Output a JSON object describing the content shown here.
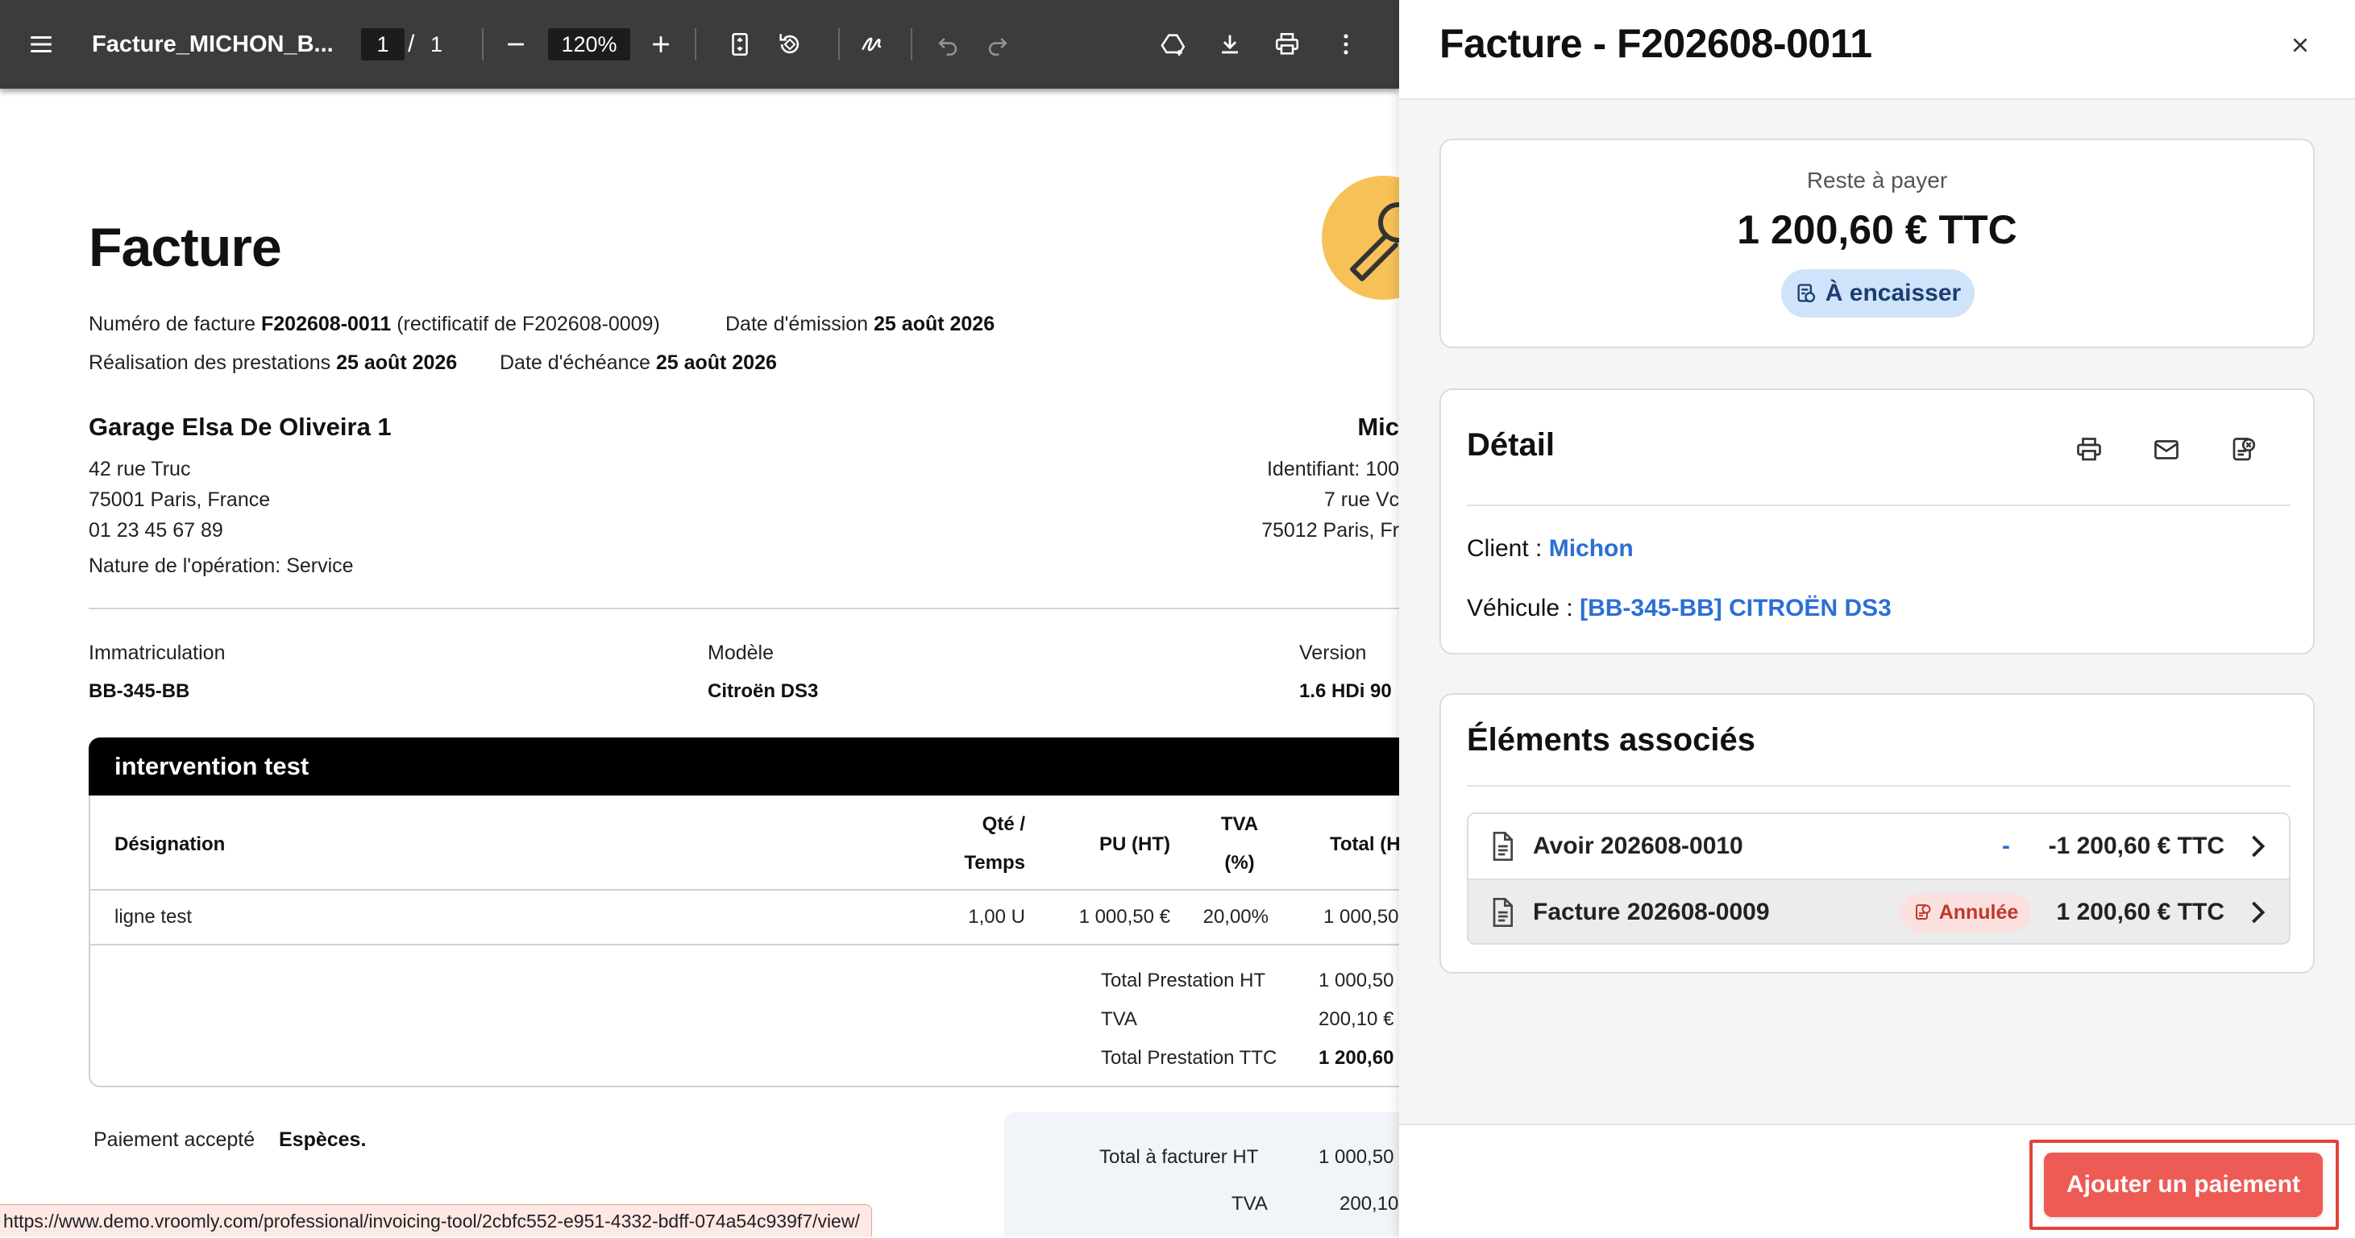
{
  "viewer": {
    "file_title": "Facture_MICHON_B...",
    "page_current": "1",
    "page_separator": "/",
    "page_total": "1",
    "zoom": "120%"
  },
  "pdf": {
    "title": "Facture",
    "meta": {
      "num_label": "Numéro de facture",
      "num_value": "F202608-0011",
      "rectif": "(rectificatif de F202608-0009)",
      "emission_label": "Date d'émission",
      "emission_value": "25 août 2026",
      "realisation_label": "Réalisation des prestations",
      "realisation_value": "25 août 2026",
      "echeance_label": "Date d'échéance",
      "echeance_value": "25 août 2026"
    },
    "garage": {
      "name": "Garage Elsa De Oliveira 1",
      "street": "42 rue Truc",
      "city": "75001 Paris, France",
      "phone": "01 23 45 67 89",
      "nature": "Nature de l'opération: Service"
    },
    "client": {
      "name": "Mic",
      "ident": "Identifiant: 100",
      "street": "7 rue Vc",
      "city": "75012 Paris, Fr"
    },
    "vehicle": {
      "immat_label": "Immatriculation",
      "immat_value": "BB-345-BB",
      "model_label": "Modèle",
      "model_value": "Citroën DS3",
      "version_label": "Version",
      "version_value": "1.6 HDi 90"
    },
    "intervention": {
      "title": "intervention test",
      "headers": {
        "designation": "Désignation",
        "qty_line1": "Qté /",
        "qty_line2": "Temps",
        "pu": "PU (HT)",
        "tva_line1": "TVA",
        "tva_line2": "(%)",
        "total": "Total (H"
      },
      "rows": [
        {
          "designation": "ligne test",
          "qty": "1,00 U",
          "pu": "1 000,50 €",
          "tva": "20,00%",
          "total": "1 000,50"
        }
      ],
      "totals": [
        {
          "label": "Total Prestation HT",
          "value": "1 000,50"
        },
        {
          "label": "TVA",
          "value": "200,10 €"
        },
        {
          "label": "Total Prestation TTC",
          "value": "1 200,60"
        }
      ]
    },
    "payment_label": "Paiement accepté",
    "payment_value": "Espèces.",
    "summary": [
      {
        "label": "Total à facturer HT",
        "value": "1 000,50"
      },
      {
        "label": "TVA",
        "value": "200,10"
      }
    ]
  },
  "status_url": "https://www.demo.vroomly.com/professional/invoicing-tool/2cbfc552-e951-4332-bdff-074a54c939f7/view/",
  "drawer": {
    "title": "Facture - F202608-0011",
    "balance": {
      "label": "Reste à payer",
      "amount": "1 200,60 € TTC",
      "badge": "À encaisser"
    },
    "detail": {
      "title": "Détail",
      "client_label": "Client :",
      "client_value": "Michon",
      "vehicle_label": "Véhicule :",
      "vehicle_value": "[BB-345-BB] CITROËN DS3"
    },
    "associated": {
      "title": "Éléments associés",
      "items": [
        {
          "name": "Avoir 202608-0010",
          "status": "-",
          "amount": "-1 200,60 € TTC"
        },
        {
          "name": "Facture 202608-0009",
          "status": "Annulée",
          "amount": "1 200,60 € TTC"
        }
      ]
    },
    "add_payment_label": "Ajouter un paiement"
  },
  "colors": {
    "toolbar_bg": "#3c3c3c",
    "link": "#2a6fd6",
    "badge_blue_bg": "#cfe3fa",
    "badge_red_bg": "#fbe0df",
    "primary_button": "#ee5b55",
    "highlight_outline": "#e5423a"
  }
}
